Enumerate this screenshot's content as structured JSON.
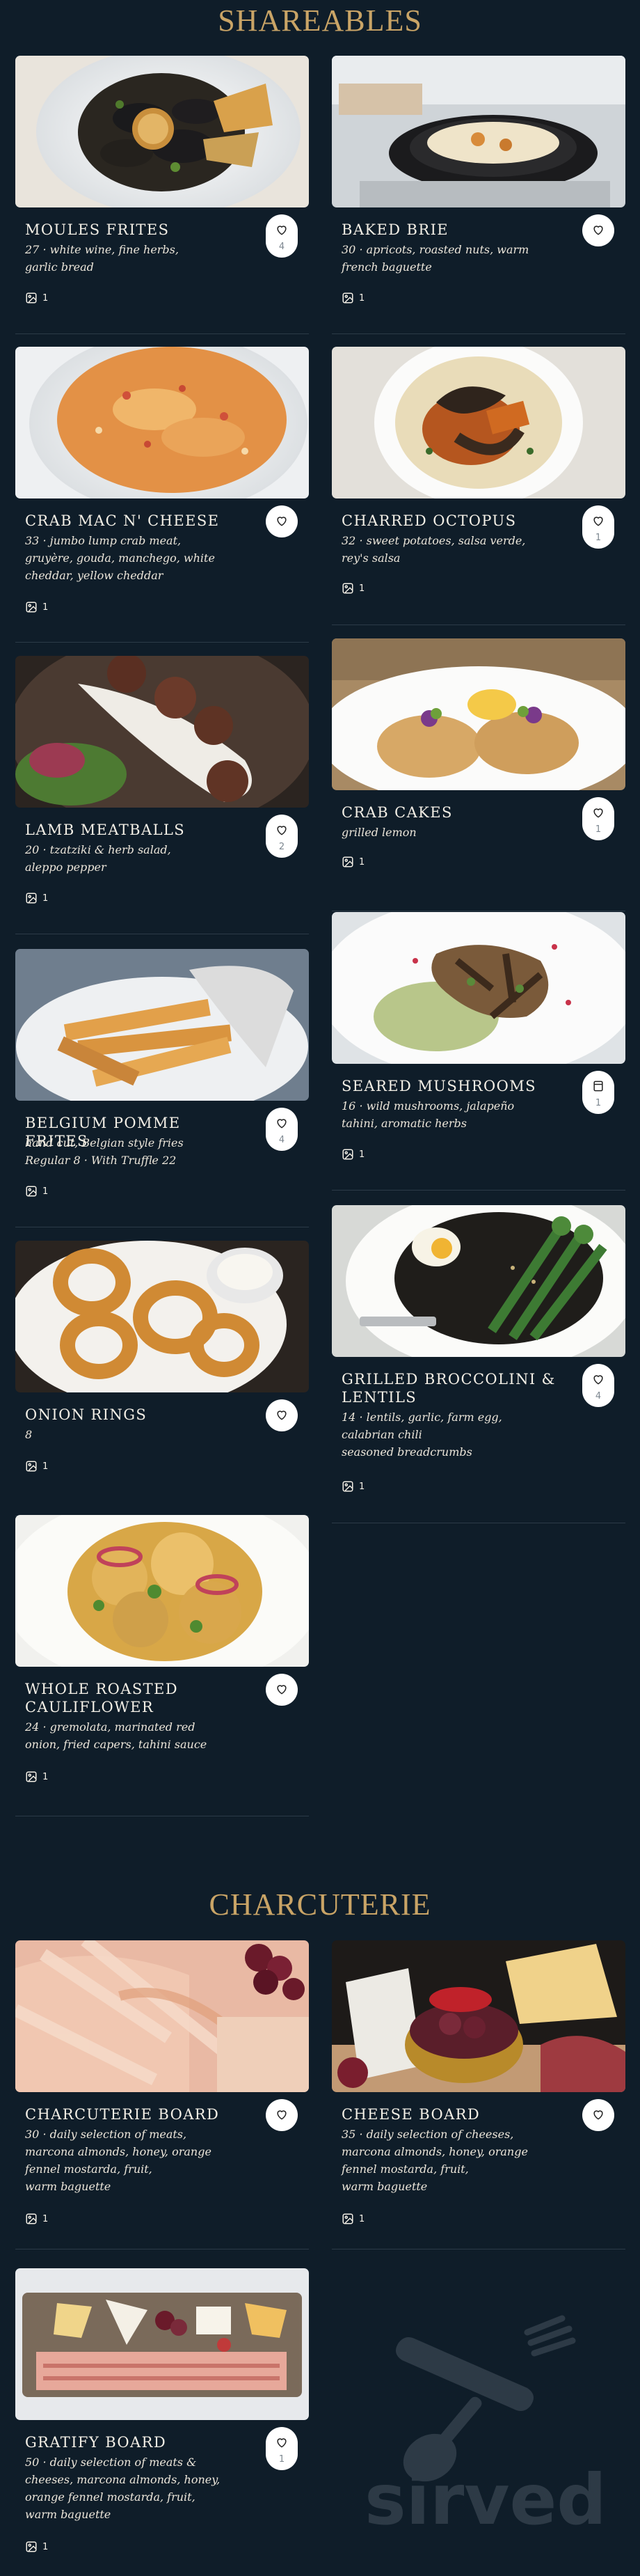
{
  "sections": [
    {
      "title": "SHAREABLES"
    },
    {
      "title": "CHARCUTERIE"
    }
  ],
  "items": [
    {
      "name": "MOULES FRITES",
      "description": "27 · white wine, fine herbs,\ngarlic bread",
      "favorites": "4",
      "photo_count": "1"
    },
    {
      "name": "BAKED BRIE",
      "description": "30 · apricots, roasted nuts, warm\nfrench baguette",
      "favorites": "",
      "photo_count": "1"
    },
    {
      "name": "CRAB MAC N' CHEESE",
      "description": "33 · jumbo lump crab meat,\ngruyère, gouda, manchego, white\ncheddar, yellow cheddar",
      "favorites": "",
      "photo_count": "1"
    },
    {
      "name": "CHARRED OCTOPUS",
      "description": "32 · sweet potatoes, salsa verde,\nrey's salsa",
      "favorites": "1",
      "photo_count": "1"
    },
    {
      "name": "LAMB MEATBALLS",
      "description": "20 · tzatziki & herb salad,\naleppo pepper",
      "favorites": "2",
      "photo_count": "1"
    },
    {
      "name": "CRAB CAKES",
      "description": "grilled lemon",
      "favorites": "1",
      "photo_count": "1"
    },
    {
      "name": "BELGIUM POMME FRITES",
      "description": "hand cut, Belgian style fries\nRegular 8 · With Truffle 22",
      "favorites": "4",
      "photo_count": "1"
    },
    {
      "name": "SEARED MUSHROOMS",
      "description": "16 · wild mushrooms, jalapeño\ntahini, aromatic herbs",
      "favorites": "1",
      "photo_count": "1"
    },
    {
      "name": "ONION RINGS",
      "description": "8",
      "favorites": "",
      "photo_count": "1"
    },
    {
      "name": "GRILLED BROCCOLINI & LENTILS",
      "description": "14 · lentils, garlic, farm egg,\ncalabrian chili\nseasoned breadcrumbs",
      "favorites": "4",
      "photo_count": "1"
    },
    {
      "name": "WHOLE ROASTED CAULIFLOWER",
      "description": "24 · gremolata, marinated red\nonion, fried capers, tahini sauce",
      "favorites": "",
      "photo_count": "1"
    },
    {
      "name": "CHARCUTERIE BOARD",
      "description": "30 · daily selection of meats,\nmarcona almonds, honey, orange\nfennel mostarda, fruit,\nwarm baguette",
      "favorites": "",
      "photo_count": "1"
    },
    {
      "name": "CHEESE BOARD",
      "description": "35 · daily selection of cheeses,\nmarcona almonds, honey, orange\nfennel mostarda, fruit,\nwarm baguette",
      "favorites": "",
      "photo_count": "1"
    },
    {
      "name": "GRATIFY BOARD",
      "description": "50 · daily selection of meats &\ncheeses, marcona almonds, honey,\norange fennel mostarda, fruit,\nwarm baguette",
      "favorites": "1",
      "photo_count": "1"
    }
  ],
  "brand": {
    "wordmark": "sirved"
  },
  "icons": {
    "favorite": "heart-icon",
    "favorite_alt": "bookmark-icon",
    "photos": "image-icon",
    "brand": "fork-spoon-icon"
  },
  "colors": {
    "background": "#0f1d29",
    "accent": "#c9a466",
    "text": "#f3efe6"
  }
}
